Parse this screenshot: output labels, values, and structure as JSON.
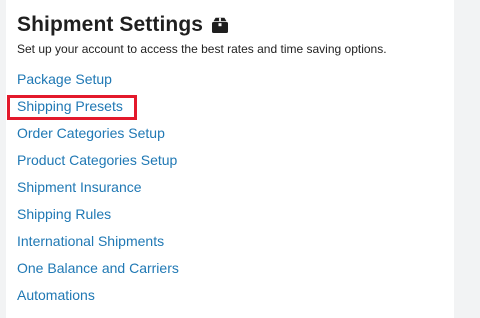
{
  "page": {
    "title": "Shipment Settings",
    "title_icon": "box-icon",
    "subtitle": "Set up your account to access the best rates and time saving options."
  },
  "links": [
    "Package Setup",
    "Shipping Presets",
    "Order Categories Setup",
    "Product Categories Setup",
    "Shipment Insurance",
    "Shipping Rules",
    "International Shipments",
    "One Balance and Carriers",
    "Automations"
  ],
  "highlighted_link": "Shipping Presets",
  "colors": {
    "link": "#1f78b4",
    "highlight_border": "#e3192b",
    "title": "#1f1f1f"
  }
}
